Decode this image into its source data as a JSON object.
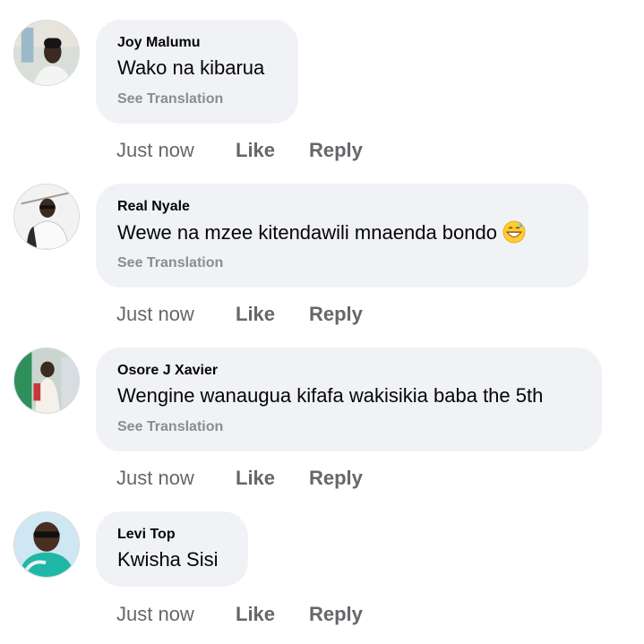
{
  "comments": [
    {
      "author": "Joy Malumu",
      "text": "Wako na kibarua",
      "translate": "See Translation",
      "time": "Just now",
      "like": "Like",
      "reply": "Reply"
    },
    {
      "author": "Real Nyale",
      "text": "Wewe na mzee kitendawili mnaenda bondo",
      "emoji": "grinning-sweat-emoji",
      "translate": "See Translation",
      "time": "Just now",
      "like": "Like",
      "reply": "Reply"
    },
    {
      "author": "Osore J Xavier",
      "text": "Wengine wanaugua kifafa wakisikia baba the 5th",
      "translate": "See Translation",
      "time": "Just now",
      "like": "Like",
      "reply": "Reply"
    },
    {
      "author": "Levi Top",
      "text": "Kwisha Sisi",
      "time": "Just now",
      "like": "Like",
      "reply": "Reply"
    }
  ],
  "colors": {
    "bubble": "#f0f2f5",
    "text": "#050505",
    "meta": "#65676b",
    "translate": "#8a8d91"
  }
}
